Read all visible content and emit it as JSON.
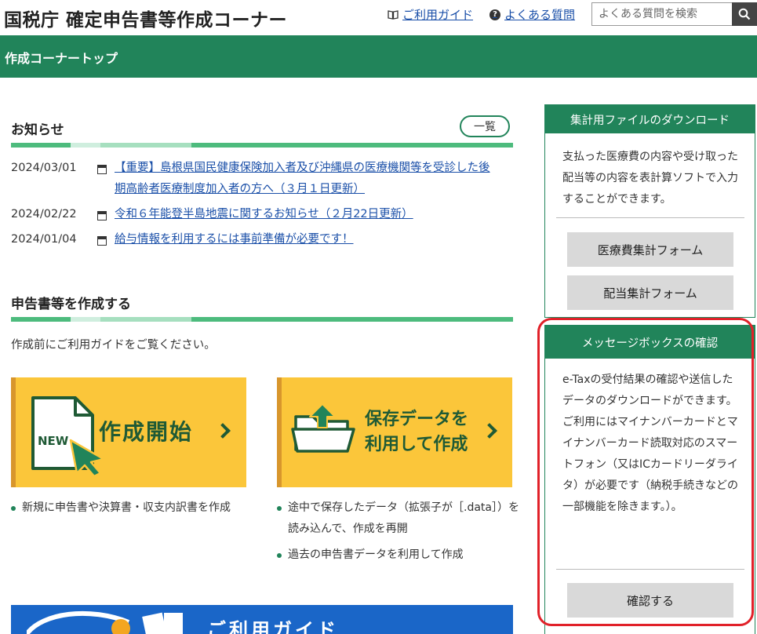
{
  "header": {
    "title": "国税庁 確定申告書等作成コーナー",
    "guide_link": "ご利用ガイド",
    "faq_link": "よくある質問",
    "search_placeholder": "よくある質問を検索"
  },
  "greenbar": {
    "title": "作成コーナートップ"
  },
  "news": {
    "heading": "お知らせ",
    "list_button": "一覧",
    "items": [
      {
        "date": "2024/03/01",
        "text": "【重要】島根県国民健康保険加入者及び沖縄県の医療機関等を受診した後期高齢者医療制度加入者の方へ（３月１日更新）"
      },
      {
        "date": "2024/02/22",
        "text": "令和６年能登半島地震に関するお知らせ（２月22日更新）"
      },
      {
        "date": "2024/01/04",
        "text": "給与情報を利用するには事前準備が必要です！"
      }
    ]
  },
  "create": {
    "heading": "申告書等を作成する",
    "intro": "作成前にご利用ガイドをご覧ください。",
    "start_button": {
      "badge": "NEW",
      "label": "作成開始"
    },
    "saved_button": {
      "label_line1": "保存データを",
      "label_line2": "利用して作成"
    },
    "start_bullets": [
      "新規に申告書や決算書・収支内訳書を作成"
    ],
    "saved_bullets": [
      "途中で保存したデータ（拡張子が［.data］）を読み込んで、作成を再開",
      "過去の申告書データを利用して作成"
    ]
  },
  "guide_banner": {
    "text": "ご利用ガイド"
  },
  "sidebar": {
    "download": {
      "heading": "集計用ファイルのダウンロード",
      "text": "支払った医療費の内容や受け取った配当等の内容を表計算ソフトで入力することができます。",
      "buttons": [
        "医療費集計フォーム",
        "配当集計フォーム"
      ]
    },
    "messagebox": {
      "heading": "メッセージボックスの確認",
      "text": "e-Taxの受付結果の確認や送信したデータのダウンロードができます。\nご利用にはマイナンバーカードとマイナンバーカード読取対応のスマートフォン（又はICカードリーダライタ）が必要です（納税手続きなどの一部機能を除きます。）。",
      "button": "確認する"
    }
  },
  "colors": {
    "primary_green": "#21845a",
    "accent_yellow": "#fbc63a",
    "link_blue": "#1a4fa8",
    "highlight_red": "#e12129"
  }
}
